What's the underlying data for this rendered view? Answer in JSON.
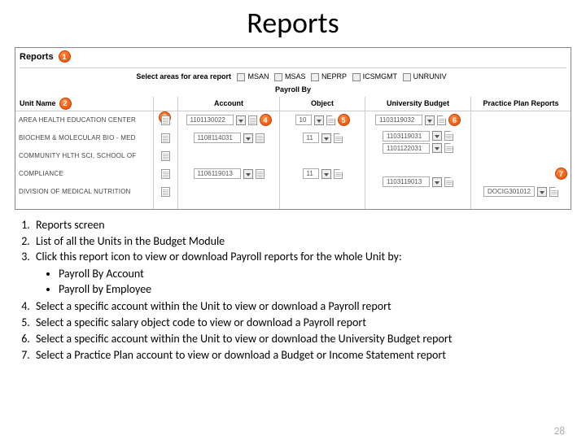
{
  "title": "Reports",
  "screenshot": {
    "reports_label": "Reports",
    "select_areas_label": "Select areas for area report",
    "area_options": [
      "MSAN",
      "MSAS",
      "NEPRP",
      "ICSMGMT",
      "UNRUNIV"
    ],
    "payroll_by_label": "Payroll By",
    "headers": {
      "unit": "Unit Name",
      "account": "Account",
      "object": "Object",
      "university": "University Budget",
      "plan": "Practice Plan Reports"
    },
    "units": [
      "AREA HEALTH EDUCATION CENTER",
      "BIOCHEM & MOLECULAR BIO - MED",
      "COMMUNITY HLTH SCI, SCHOOL OF",
      "COMPLIANCE",
      "DIVISION OF MEDICAL NUTRITION"
    ],
    "accounts": [
      [
        "1101130022"
      ],
      [
        "1108114031"
      ],
      [
        ""
      ],
      [
        "1106119013"
      ],
      [
        ""
      ]
    ],
    "objects": [
      [
        "10"
      ],
      [
        "11"
      ],
      [
        ""
      ],
      [
        "11"
      ],
      [
        ""
      ]
    ],
    "university": [
      [
        "1103119032"
      ],
      [
        "1103119031",
        "1101122031"
      ],
      [
        ""
      ],
      [
        "1103119013"
      ],
      [
        ""
      ]
    ],
    "plan": [
      [
        ""
      ],
      [
        ""
      ],
      [
        ""
      ],
      [
        ""
      ],
      [
        "DOCIG301012"
      ]
    ]
  },
  "annotations": [
    "1",
    "2",
    "3",
    "4",
    "5",
    "6",
    "7"
  ],
  "instructions": [
    "Reports screen",
    "List of all the Units in the Budget Module",
    "Click this report icon to view or download Payroll reports for the whole Unit by:",
    "Select a specific account within the Unit to view or download a Payroll report",
    "Select a specific salary object code to view or download a Payroll report",
    "Select a specific account within the Unit to view or download the University Budget report",
    "Select a Practice Plan account to view or download a Budget or Income Statement report"
  ],
  "sub_bullets": [
    "Payroll By Account",
    "Payroll by Employee"
  ],
  "page_number": "28"
}
